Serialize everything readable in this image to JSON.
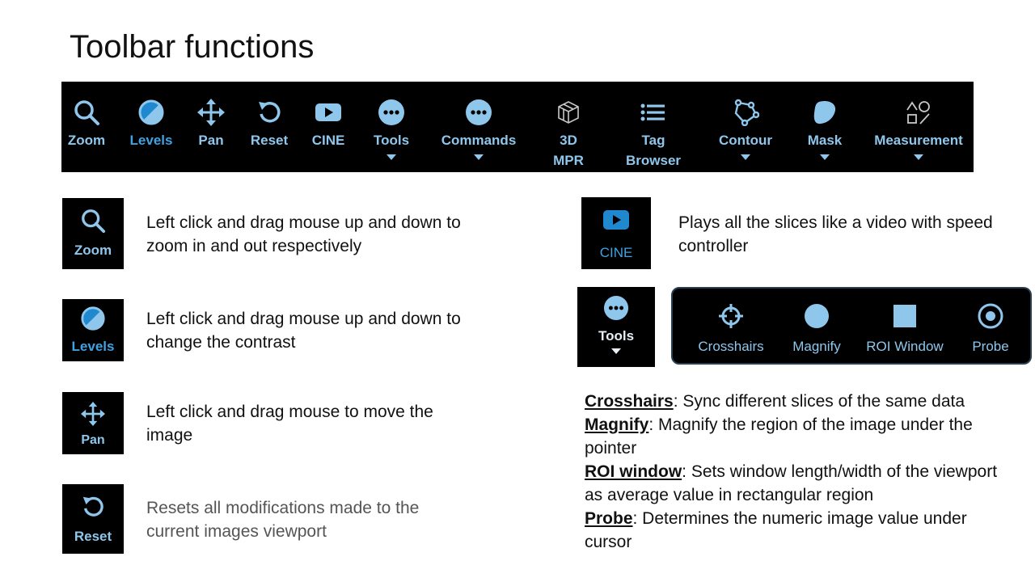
{
  "page": {
    "title": "Toolbar functions"
  },
  "toolbar": {
    "items": [
      {
        "label": "Zoom",
        "icon": "search-icon"
      },
      {
        "label": "Levels",
        "icon": "levels-icon",
        "active": true
      },
      {
        "label": "Pan",
        "icon": "move-icon"
      },
      {
        "label": "Reset",
        "icon": "reset-icon"
      },
      {
        "label": "CINE",
        "icon": "play-icon"
      },
      {
        "label": "Tools",
        "icon": "more-icon",
        "dropdown": true
      },
      {
        "label": "Commands",
        "icon": "more-icon",
        "dropdown": true
      },
      {
        "label": "3D MPR",
        "icon": "cube-icon"
      },
      {
        "label": "Tag Browser",
        "icon": "list-icon"
      },
      {
        "label": "Contour",
        "icon": "polygon-icon",
        "dropdown": true
      },
      {
        "label": "Mask",
        "icon": "mask-icon",
        "dropdown": true
      },
      {
        "label": "Measurement",
        "icon": "shapes-icon",
        "dropdown": true
      }
    ]
  },
  "sections": {
    "zoom": {
      "label": "Zoom",
      "text": "Left click and drag mouse up and down to zoom in and out respectively"
    },
    "levels": {
      "label": "Levels",
      "text": "Left click and drag mouse up and down to change the contrast"
    },
    "pan": {
      "label": "Pan",
      "text": "Left click and drag mouse to move the image"
    },
    "reset": {
      "label": "Reset",
      "text": "Resets all modifications made to the current images viewport"
    },
    "cine": {
      "label": "CINE",
      "text": "Plays all the slices like a video with speed controller"
    },
    "tools": {
      "label": "Tools"
    }
  },
  "tools_popup": {
    "items": [
      {
        "label": "Crosshairs",
        "icon": "crosshairs-icon"
      },
      {
        "label": "Magnify",
        "icon": "circle-icon"
      },
      {
        "label": "ROI Window",
        "icon": "square-icon"
      },
      {
        "label": "Probe",
        "icon": "probe-icon"
      }
    ]
  },
  "tool_notes": [
    {
      "term": "Crosshairs",
      "text": ": Sync different slices of the same data"
    },
    {
      "term": "Magnify",
      "text": ": Magnify the region of  the image under the pointer"
    },
    {
      "term": "ROI window",
      "text": ": Sets window length/width of the viewport as average value in rectangular region"
    },
    {
      "term": "Probe",
      "text": ": Determines the numeric image value under cursor"
    }
  ],
  "colors": {
    "icon": "#8ec6ec",
    "active": "#3fa2e3",
    "background": "#000000"
  }
}
